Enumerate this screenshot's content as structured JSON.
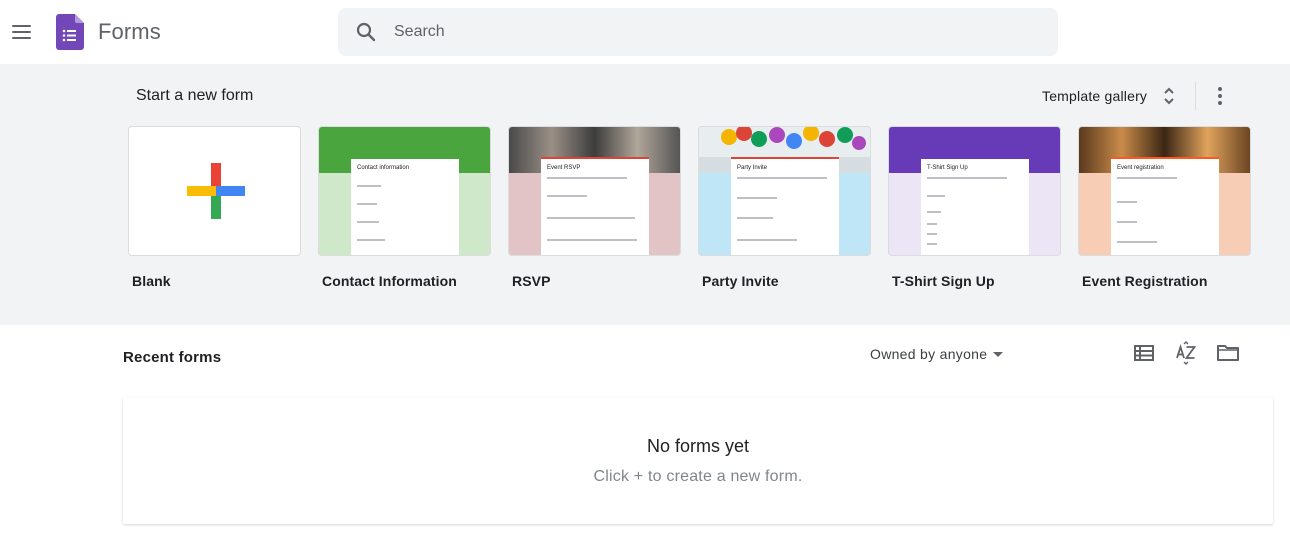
{
  "header": {
    "app_title": "Forms",
    "search": {
      "placeholder": "Search",
      "value": ""
    },
    "brand_color": "#673ab7"
  },
  "templates": {
    "section_title": "Start a new form",
    "gallery_label": "Template gallery",
    "items": [
      {
        "label": "Blank"
      },
      {
        "label": "Contact Information",
        "sheet_title": "Contact information",
        "accent": "#4caf50"
      },
      {
        "label": "RSVP",
        "sheet_title": "Event RSVP",
        "accent": "#db4437"
      },
      {
        "label": "Party Invite",
        "sheet_title": "Party Invite",
        "accent": "#db4437"
      },
      {
        "label": "T-Shirt Sign Up",
        "sheet_title": "T-Shirt Sign Up",
        "accent": "#673ab7"
      },
      {
        "label": "Event Registration",
        "sheet_title": "Event registration",
        "accent": "#ff5722"
      }
    ]
  },
  "recent": {
    "title": "Recent forms",
    "owner_filter": "Owned by anyone",
    "empty_title": "No forms yet",
    "empty_subtitle": "Click + to create a new form."
  },
  "icons": {
    "menu": "hamburger-icon",
    "search": "search-icon",
    "gallery_toggle": "unfold-more-icon",
    "more": "more-vert-icon",
    "list_view": "list-view-icon",
    "sort": "sort-az-icon",
    "folder": "folder-icon"
  }
}
